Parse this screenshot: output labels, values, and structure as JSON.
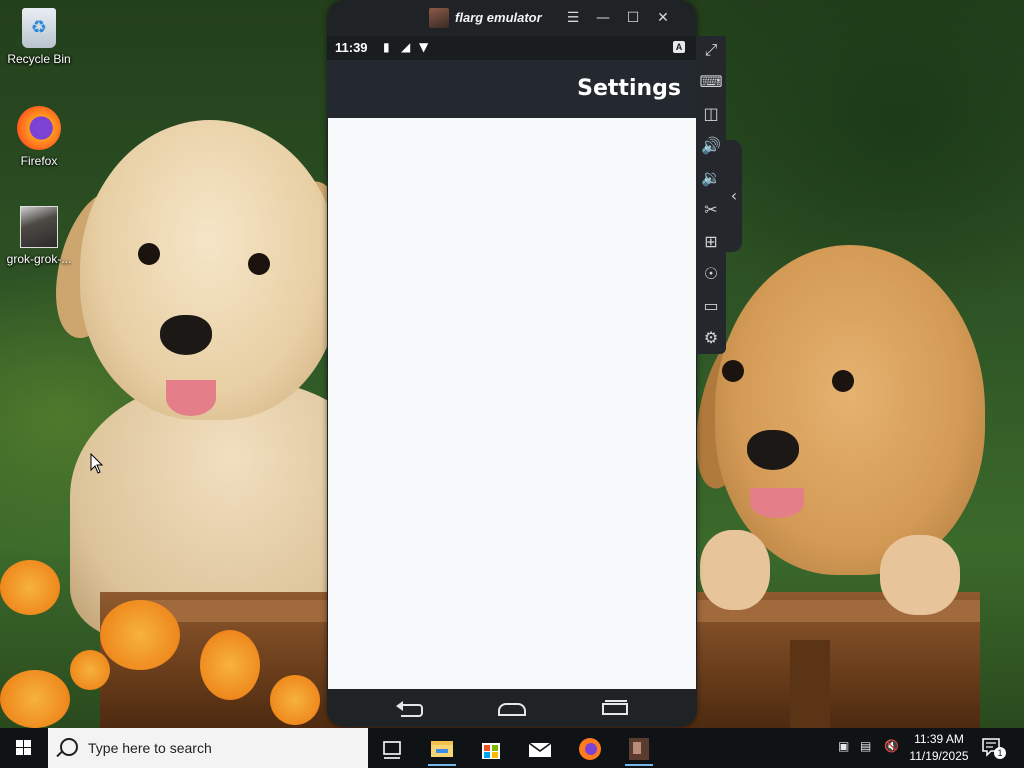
{
  "desktop": {
    "icons": [
      {
        "label": "Recycle Bin"
      },
      {
        "label": "Firefox"
      },
      {
        "label": "grok-grok-..."
      }
    ]
  },
  "emulator": {
    "window_title": "flarg emulator",
    "controls": {
      "menu_icon": "menu-icon",
      "minimize_icon": "minimize-icon",
      "maximize_icon": "maximize-icon",
      "close_icon": "close-icon"
    },
    "status_bar": {
      "time": "11:39",
      "badge": "A"
    },
    "app_bar_title": "Settings",
    "sidebar_tools": [
      "fullscreen-icon",
      "keyboard-icon",
      "install-apk-icon",
      "volume-up-icon",
      "volume-down-icon",
      "screenshot-icon",
      "multi-instance-icon",
      "location-icon",
      "shake-icon",
      "settings-icon"
    ],
    "nav": [
      "back-icon",
      "home-icon",
      "recent-apps-icon"
    ]
  },
  "taskbar": {
    "search_placeholder": "Type here to search",
    "apps": [
      "task-view-icon",
      "file-explorer-icon",
      "store-icon",
      "mail-icon",
      "firefox-icon",
      "flarg-emulator-icon"
    ],
    "clock_time": "11:39 AM",
    "clock_date": "11/19/2025",
    "notification_count": "1"
  },
  "colors": {
    "emulator_frame": "#1f2326",
    "app_bar": "#23292e",
    "content_bg": "#f8f9fa",
    "taskbar": "#101316",
    "accent": "#76b9ed"
  }
}
